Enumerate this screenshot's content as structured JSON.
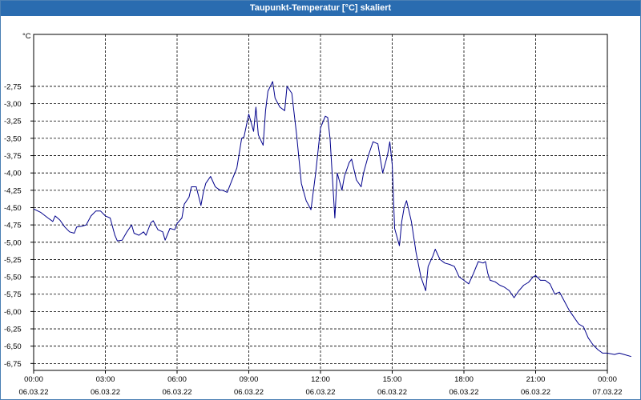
{
  "window": {
    "title": "Taupunkt-Temperatur [°C] skaliert"
  },
  "chart_data": {
    "type": "line",
    "title": "Taupunkt-Temperatur [°C] skaliert",
    "ylabel": "°C",
    "xlabel": "",
    "ylim": [
      -6.85,
      -2.0
    ],
    "xlim": [
      0,
      24
    ],
    "grid": true,
    "y_ticks": [
      -2.75,
      -3.0,
      -3.25,
      -3.5,
      -3.75,
      -4.0,
      -4.25,
      -4.5,
      -4.75,
      -5.0,
      -5.25,
      -5.5,
      -5.75,
      -6.0,
      -6.25,
      -6.5,
      -6.75
    ],
    "y_tick_labels": [
      "-2,75",
      "-3,00",
      "-3,25",
      "-3,50",
      "-3,75",
      "-4,00",
      "-4,25",
      "-4,50",
      "-4,75",
      "-5,00",
      "-5,25",
      "-5,50",
      "-5,75",
      "-6,00",
      "-6,25",
      "-6,50",
      "-6,75"
    ],
    "x_ticks": [
      {
        "hours": 0,
        "time": "00:00",
        "date": "06.03.22"
      },
      {
        "hours": 3,
        "time": "03:00",
        "date": "06.03.22"
      },
      {
        "hours": 6,
        "time": "06:00",
        "date": "06.03.22"
      },
      {
        "hours": 9,
        "time": "09:00",
        "date": "06.03.22"
      },
      {
        "hours": 12,
        "time": "12:00",
        "date": "06.03.22"
      },
      {
        "hours": 15,
        "time": "15:00",
        "date": "06.03.22"
      },
      {
        "hours": 18,
        "time": "18:00",
        "date": "06.03.22"
      },
      {
        "hours": 21,
        "time": "21:00",
        "date": "06.03.22"
      },
      {
        "hours": 24,
        "time": "00:00",
        "date": "07.03.22"
      }
    ],
    "series": [
      {
        "color": "#00008b",
        "points": [
          [
            0.0,
            -4.52
          ],
          [
            0.3,
            -4.57
          ],
          [
            0.6,
            -4.65
          ],
          [
            0.8,
            -4.7
          ],
          [
            0.9,
            -4.62
          ],
          [
            1.1,
            -4.68
          ],
          [
            1.3,
            -4.78
          ],
          [
            1.5,
            -4.85
          ],
          [
            1.7,
            -4.87
          ],
          [
            1.8,
            -4.78
          ],
          [
            2.0,
            -4.77
          ],
          [
            2.2,
            -4.75
          ],
          [
            2.4,
            -4.62
          ],
          [
            2.6,
            -4.55
          ],
          [
            2.8,
            -4.55
          ],
          [
            3.0,
            -4.62
          ],
          [
            3.2,
            -4.65
          ],
          [
            3.4,
            -4.9
          ],
          [
            3.5,
            -4.98
          ],
          [
            3.7,
            -4.97
          ],
          [
            3.9,
            -4.85
          ],
          [
            4.1,
            -4.75
          ],
          [
            4.2,
            -4.87
          ],
          [
            4.4,
            -4.9
          ],
          [
            4.6,
            -4.85
          ],
          [
            4.7,
            -4.9
          ],
          [
            4.9,
            -4.72
          ],
          [
            5.0,
            -4.69
          ],
          [
            5.2,
            -4.82
          ],
          [
            5.4,
            -4.85
          ],
          [
            5.5,
            -4.97
          ],
          [
            5.7,
            -4.8
          ],
          [
            5.9,
            -4.82
          ],
          [
            6.0,
            -4.73
          ],
          [
            6.2,
            -4.65
          ],
          [
            6.3,
            -4.45
          ],
          [
            6.5,
            -4.35
          ],
          [
            6.6,
            -4.2
          ],
          [
            6.8,
            -4.2
          ],
          [
            7.0,
            -4.47
          ],
          [
            7.1,
            -4.28
          ],
          [
            7.2,
            -4.15
          ],
          [
            7.4,
            -4.05
          ],
          [
            7.6,
            -4.2
          ],
          [
            7.8,
            -4.25
          ],
          [
            7.9,
            -4.25
          ],
          [
            8.1,
            -4.28
          ],
          [
            8.3,
            -4.1
          ],
          [
            8.5,
            -3.93
          ],
          [
            8.7,
            -3.5
          ],
          [
            8.8,
            -3.48
          ],
          [
            9.0,
            -3.15
          ],
          [
            9.2,
            -3.4
          ],
          [
            9.3,
            -3.05
          ],
          [
            9.4,
            -3.45
          ],
          [
            9.6,
            -3.6
          ],
          [
            9.7,
            -3.1
          ],
          [
            9.8,
            -2.82
          ],
          [
            10.0,
            -2.68
          ],
          [
            10.1,
            -2.92
          ],
          [
            10.3,
            -3.05
          ],
          [
            10.5,
            -3.1
          ],
          [
            10.6,
            -2.75
          ],
          [
            10.8,
            -2.85
          ],
          [
            11.0,
            -3.45
          ],
          [
            11.2,
            -4.15
          ],
          [
            11.4,
            -4.4
          ],
          [
            11.6,
            -4.53
          ],
          [
            11.8,
            -4.0
          ],
          [
            12.0,
            -3.35
          ],
          [
            12.2,
            -3.18
          ],
          [
            12.3,
            -3.2
          ],
          [
            12.4,
            -3.5
          ],
          [
            12.6,
            -4.65
          ],
          [
            12.7,
            -4.0
          ],
          [
            12.9,
            -4.25
          ],
          [
            13.0,
            -4.05
          ],
          [
            13.2,
            -3.85
          ],
          [
            13.3,
            -3.8
          ],
          [
            13.5,
            -4.1
          ],
          [
            13.7,
            -4.2
          ],
          [
            13.8,
            -4.0
          ],
          [
            14.0,
            -3.75
          ],
          [
            14.2,
            -3.55
          ],
          [
            14.4,
            -3.58
          ],
          [
            14.6,
            -4.0
          ],
          [
            14.8,
            -3.75
          ],
          [
            14.9,
            -3.55
          ],
          [
            15.0,
            -3.88
          ],
          [
            15.1,
            -4.8
          ],
          [
            15.3,
            -5.05
          ],
          [
            15.4,
            -4.7
          ],
          [
            15.5,
            -4.5
          ],
          [
            15.6,
            -4.4
          ],
          [
            15.8,
            -4.7
          ],
          [
            16.0,
            -5.15
          ],
          [
            16.2,
            -5.5
          ],
          [
            16.4,
            -5.7
          ],
          [
            16.5,
            -5.35
          ],
          [
            16.7,
            -5.2
          ],
          [
            16.8,
            -5.1
          ],
          [
            17.0,
            -5.25
          ],
          [
            17.2,
            -5.3
          ],
          [
            17.4,
            -5.32
          ],
          [
            17.6,
            -5.35
          ],
          [
            17.8,
            -5.5
          ],
          [
            18.0,
            -5.55
          ],
          [
            18.2,
            -5.6
          ],
          [
            18.4,
            -5.45
          ],
          [
            18.6,
            -5.28
          ],
          [
            18.8,
            -5.3
          ],
          [
            18.9,
            -5.28
          ],
          [
            19.0,
            -5.45
          ],
          [
            19.1,
            -5.55
          ],
          [
            19.3,
            -5.57
          ],
          [
            19.5,
            -5.62
          ],
          [
            19.7,
            -5.65
          ],
          [
            19.9,
            -5.7
          ],
          [
            20.1,
            -5.8
          ],
          [
            20.3,
            -5.7
          ],
          [
            20.5,
            -5.62
          ],
          [
            20.7,
            -5.58
          ],
          [
            20.9,
            -5.5
          ],
          [
            21.0,
            -5.48
          ],
          [
            21.2,
            -5.55
          ],
          [
            21.4,
            -5.55
          ],
          [
            21.6,
            -5.6
          ],
          [
            21.8,
            -5.75
          ],
          [
            22.0,
            -5.72
          ],
          [
            22.2,
            -5.85
          ],
          [
            22.4,
            -5.98
          ],
          [
            22.6,
            -6.08
          ],
          [
            22.8,
            -6.18
          ],
          [
            23.0,
            -6.22
          ],
          [
            23.2,
            -6.38
          ],
          [
            23.4,
            -6.48
          ],
          [
            23.6,
            -6.55
          ],
          [
            23.8,
            -6.6
          ],
          [
            24.0,
            -6.6
          ],
          [
            24.3,
            -6.62
          ],
          [
            24.5,
            -6.6
          ],
          [
            24.7,
            -6.62
          ],
          [
            25.0,
            -6.65
          ]
        ]
      }
    ]
  }
}
